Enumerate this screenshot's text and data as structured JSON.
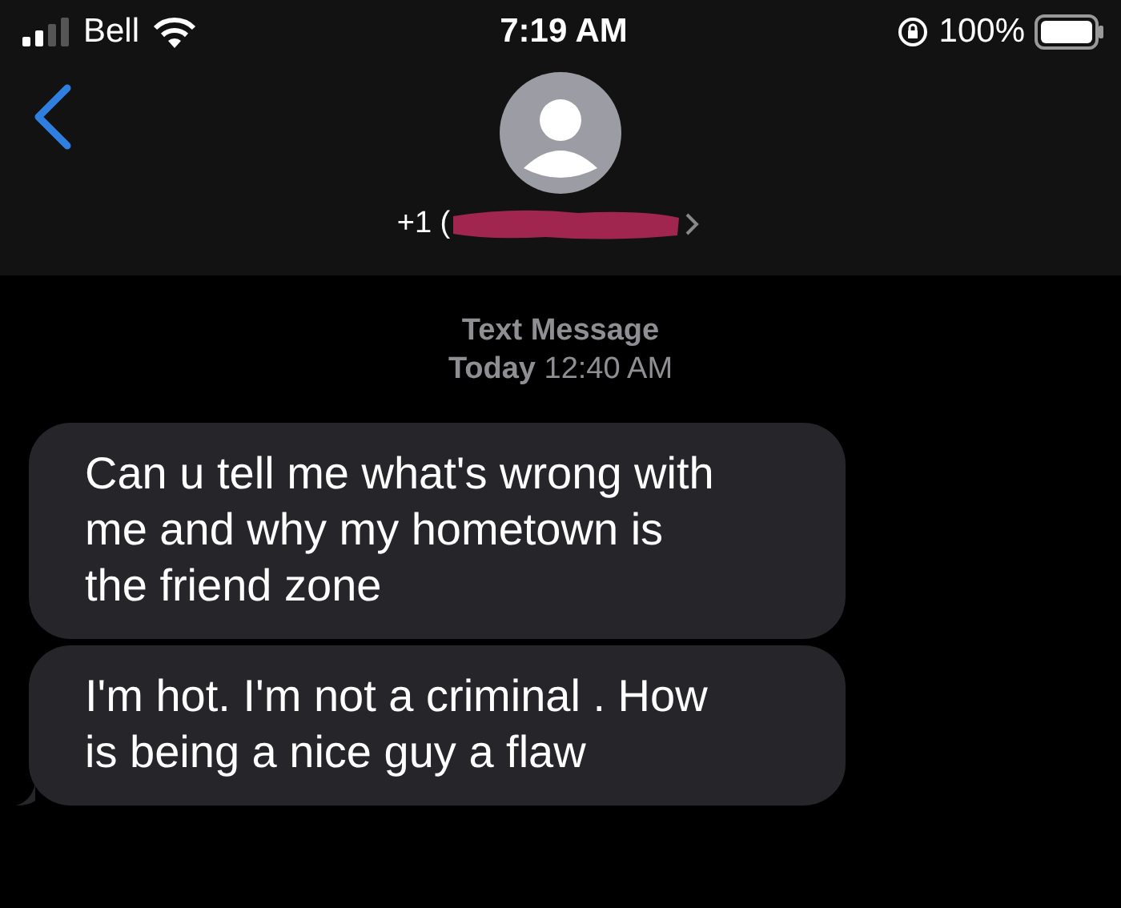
{
  "status_bar": {
    "carrier": "Bell",
    "time": "7:19 AM",
    "battery": "100%"
  },
  "header": {
    "contact": "+1 (",
    "redacted": true
  },
  "thread": {
    "label": "Text Message",
    "day": "Today",
    "time": "12:40 AM"
  },
  "messages": [
    {
      "lines": [
        "Can u tell me what's wrong with",
        "me and why my hometown is",
        "the friend zone"
      ],
      "tail": false
    },
    {
      "lines": [
        "I'm hot. I'm not a criminal . How",
        "is being a nice guy a flaw"
      ],
      "tail": true
    }
  ]
}
